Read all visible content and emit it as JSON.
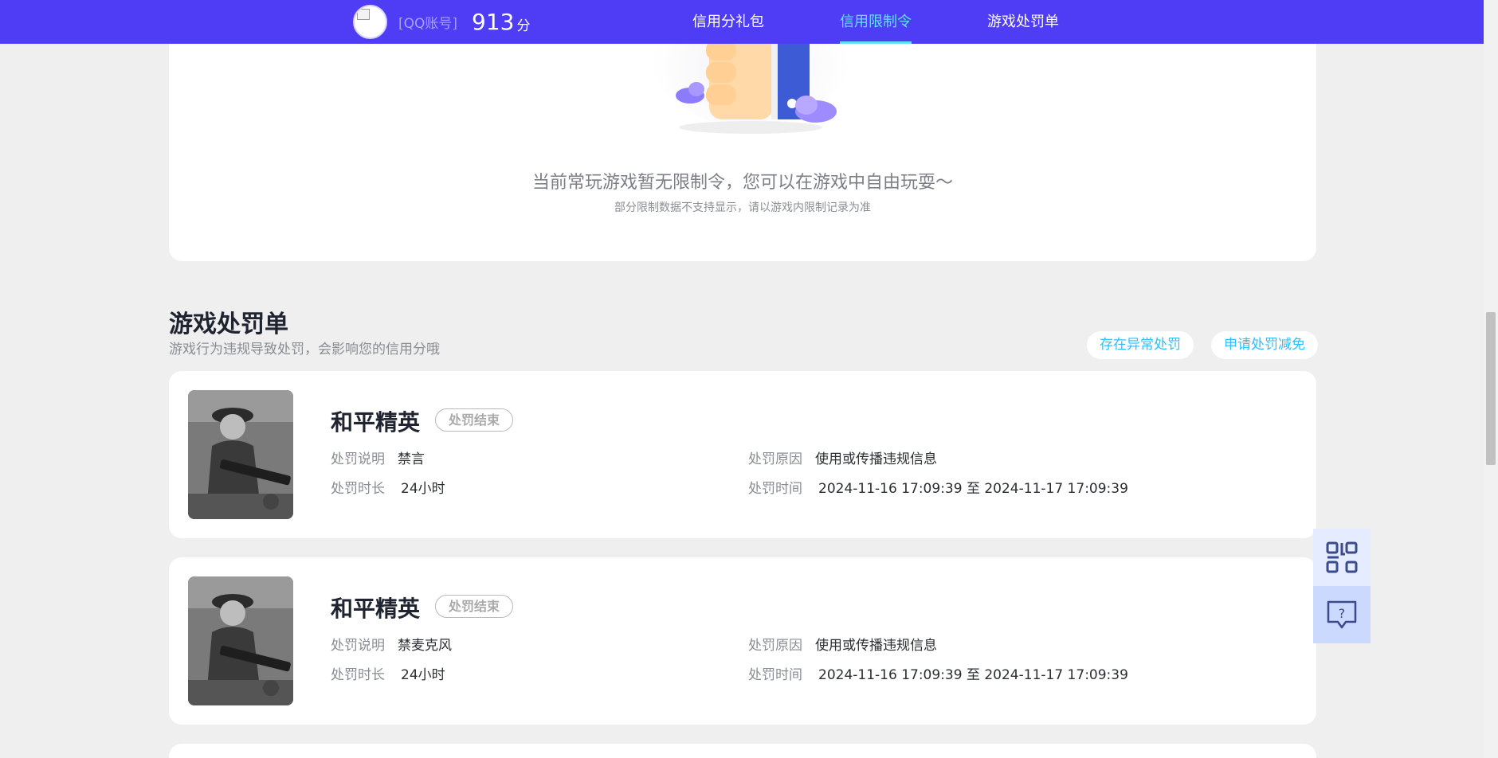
{
  "topbar": {
    "account_label": "[QQ账号]",
    "score": "913",
    "score_unit": "分",
    "nav": [
      {
        "label": "信用分礼包"
      },
      {
        "label": "信用限制令"
      },
      {
        "label": "游戏处罚单"
      }
    ]
  },
  "restriction": {
    "empty_title": "当前常玩游戏暂无限制令，您可以在游戏中自由玩耍～",
    "empty_sub": "部分限制数据不支持显示，请以游戏内限制记录为准"
  },
  "penalties_section": {
    "title": "游戏处罚单",
    "subtitle": "游戏行为违规导致处罚，会影响您的信用分哦",
    "btn_abnormal": "存在异常处罚",
    "btn_reduce": "申请处罚减免"
  },
  "penalties": [
    {
      "game": "和平精英",
      "status": "处罚结束",
      "desc_label": "处罚说明",
      "desc": "禁言",
      "reason_label": "处罚原因",
      "reason": "使用或传播违规信息",
      "duration_label": "处罚时长",
      "duration": "24小时",
      "time_label": "处罚时间",
      "time": "2024-11-16 17:09:39 至 2024-11-17 17:09:39"
    },
    {
      "game": "和平精英",
      "status": "处罚结束",
      "desc_label": "处罚说明",
      "desc": "禁麦克风",
      "reason_label": "处罚原因",
      "reason": "使用或传播违规信息",
      "duration_label": "处罚时长",
      "duration": "24小时",
      "time_label": "处罚时间",
      "time": "2024-11-16 17:09:39 至 2024-11-17 17:09:39"
    }
  ],
  "side_tools": {
    "qr_icon": "qr-code-icon",
    "help_icon": "help-chat-icon"
  },
  "colors": {
    "brand": "#4f3cf5",
    "accent": "#62e0ff",
    "link": "#2cc0ff"
  }
}
